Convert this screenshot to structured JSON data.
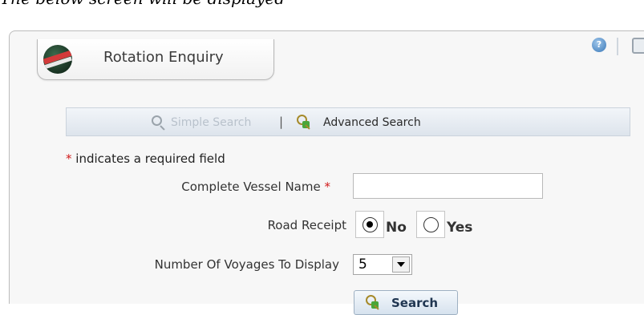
{
  "caption": "The below screen will be displayed",
  "portlet": {
    "title": "Rotation Enquiry",
    "icons": {
      "logo": "dubai-customs-logo-icon",
      "help": "help-icon",
      "print": "print-icon"
    },
    "help_glyph": "?"
  },
  "search_bar": {
    "simple_search": "Simple Search",
    "separator": "|",
    "advanced_search": "Advanced Search",
    "icons": {
      "simple": "magnifier-icon",
      "advanced": "advanced-search-icon"
    }
  },
  "form": {
    "required_marker": "*",
    "required_note": "indicates a required field",
    "vessel_name": {
      "label": "Complete Vessel Name",
      "value": ""
    },
    "road_receipt": {
      "label": "Road Receipt",
      "options": [
        {
          "label": "No",
          "checked": true
        },
        {
          "label": "Yes",
          "checked": false
        }
      ]
    },
    "voyages": {
      "label": "Number Of Voyages To Display",
      "value": "5"
    },
    "search_button": "Search"
  },
  "colors": {
    "required": "#d11a1a",
    "bar": "#dde4ec",
    "button_text": "#1f3550"
  }
}
